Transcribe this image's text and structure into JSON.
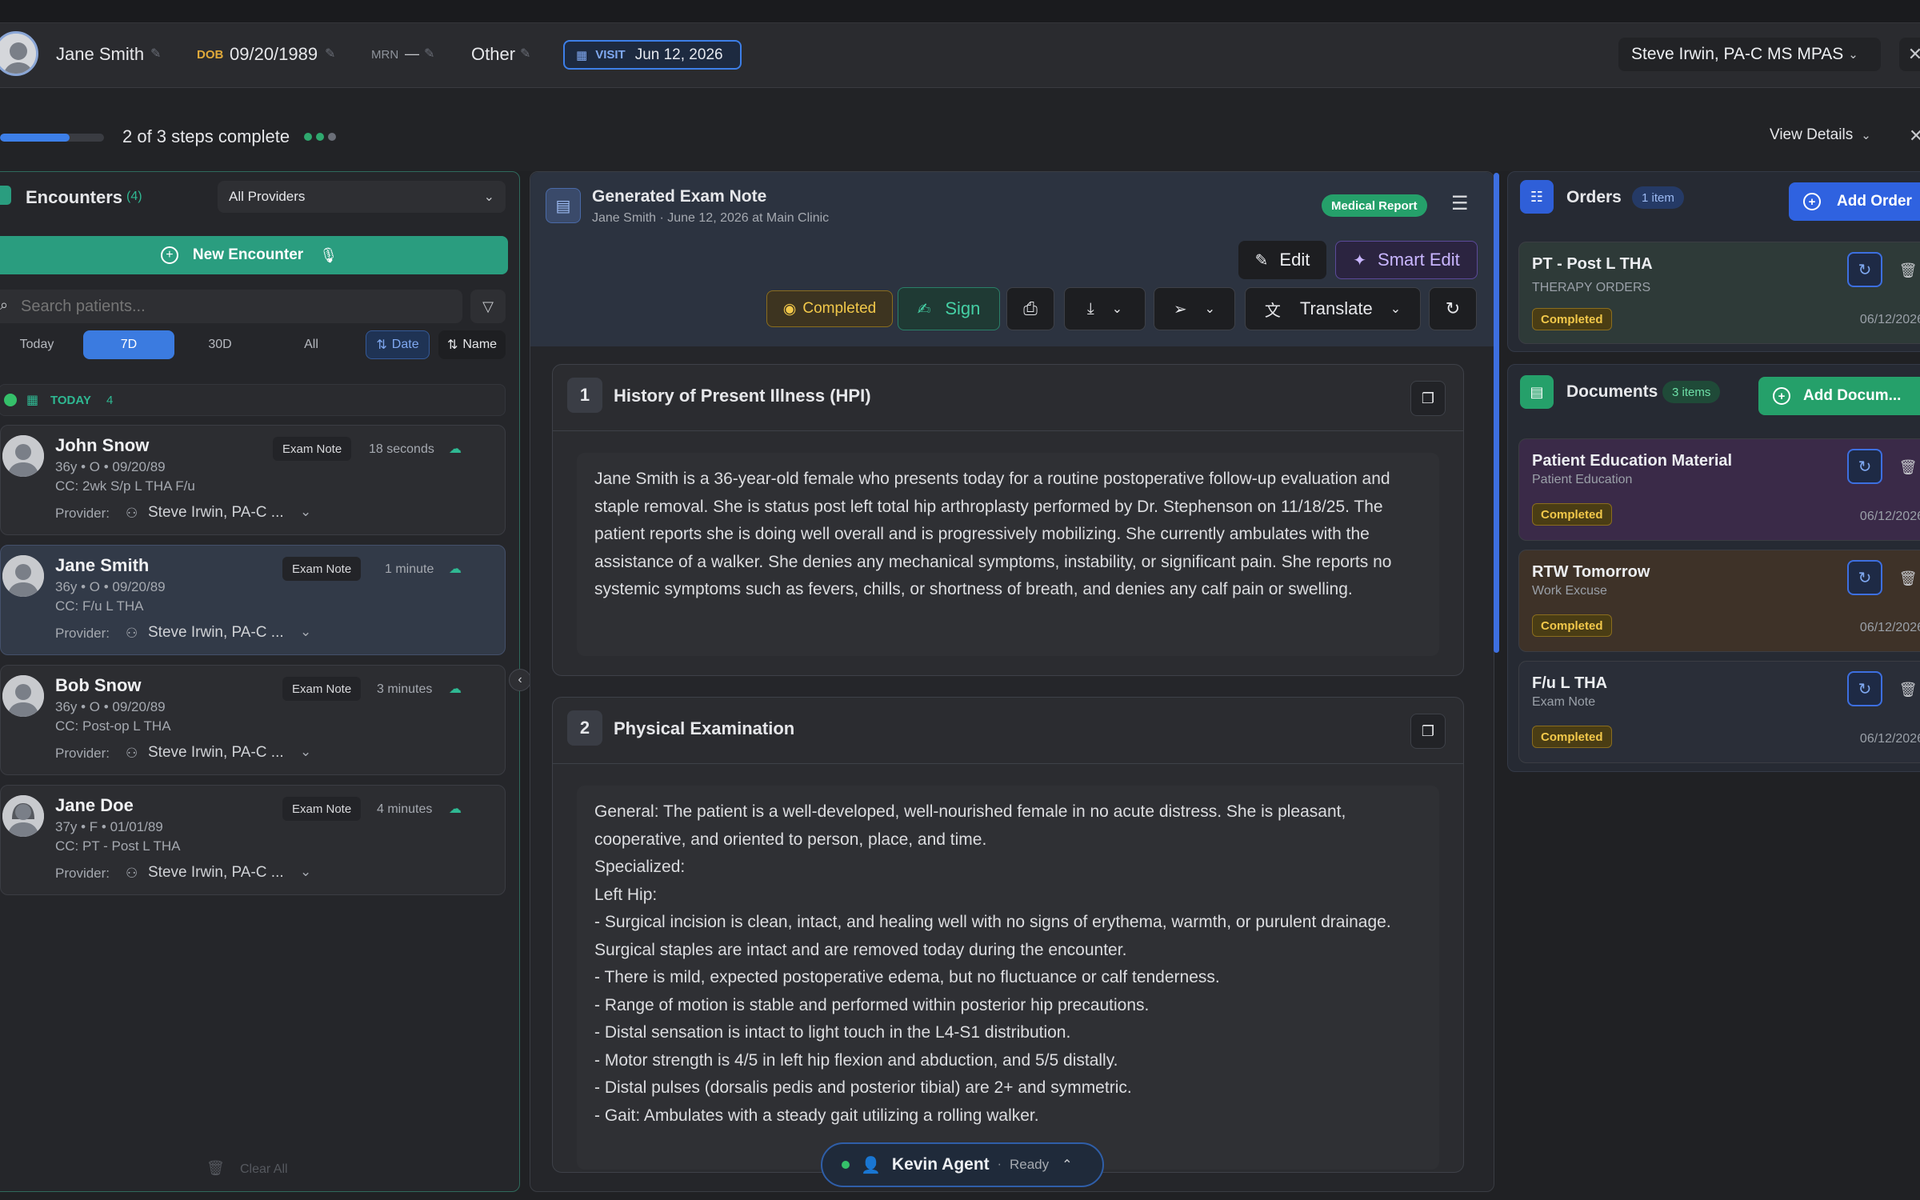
{
  "header": {
    "patient_name": "Jane Smith",
    "dob_label": "DOB",
    "dob_value": "09/20/1989",
    "mrn_label": "MRN",
    "mrn_value": "—",
    "sex_value": "Other",
    "visit_label": "VISIT",
    "visit_date": "Jun 12, 2026",
    "provider": "Steve Irwin, PA-C MS MPAS"
  },
  "progress": {
    "text": "2 of 3 steps complete",
    "fraction": 0.67,
    "view_details": "View Details"
  },
  "encounters": {
    "title": "Encounters",
    "count": "(4)",
    "provider_filter": "All Providers",
    "new_button": "New Encounter",
    "search_placeholder": "Search patients...",
    "ranges": [
      "Today",
      "7D",
      "30D",
      "All"
    ],
    "active_range": "7D",
    "sort_date": "Date",
    "sort_name": "Name",
    "group_label": "TODAY",
    "group_count": "4",
    "clear_all": "Clear All",
    "items": [
      {
        "name": "John Snow",
        "meta": "36y • O • 09/20/89",
        "cc": "CC: 2wk S/p L THA F/u",
        "tag": "Exam Note",
        "time": "18 seconds",
        "provider_label": "Provider:",
        "provider": "Steve Irwin, PA-C ..."
      },
      {
        "name": "Jane Smith",
        "meta": "36y • O • 09/20/89",
        "cc": "CC: F/u L THA",
        "tag": "Exam Note",
        "time": "1 minute",
        "provider_label": "Provider:",
        "provider": "Steve Irwin, PA-C ..."
      },
      {
        "name": "Bob Snow",
        "meta": "36y • O • 09/20/89",
        "cc": "CC: Post-op L THA",
        "tag": "Exam Note",
        "time": "3 minutes",
        "provider_label": "Provider:",
        "provider": "Steve Irwin, PA-C ..."
      },
      {
        "name": "Jane Doe",
        "meta": "37y • F • 01/01/89",
        "cc": "CC: PT - Post L THA",
        "tag": "Exam Note",
        "time": "4 minutes",
        "provider_label": "Provider:",
        "provider": "Steve Irwin, PA-C ..."
      }
    ]
  },
  "note": {
    "title": "Generated Exam Note",
    "subtitle": "Jane Smith · June 12, 2026 at Main Clinic",
    "badge": "Medical Report",
    "edit": "Edit",
    "smart_edit": "Smart Edit",
    "status": "Completed",
    "sign": "Sign",
    "translate": "Translate",
    "sections": [
      {
        "num": "1",
        "title": "History of Present Illness (HPI)",
        "body": "Jane Smith is a 36-year-old female who presents today for a routine postoperative follow-up evaluation and staple removal. She is status post left total hip arthroplasty performed by Dr. Stephenson on 11/18/25. The patient reports she is doing well overall and is progressively mobilizing. She currently ambulates with the assistance of a walker. She denies any mechanical symptoms, instability, or significant pain. She reports no systemic symptoms such as fevers, chills, or shortness of breath, and denies any calf pain or swelling."
      },
      {
        "num": "2",
        "title": "Physical Examination",
        "body": "General: The patient is a well-developed, well-nourished female in no acute distress. She is pleasant, cooperative, and oriented to person, place, and time.\nSpecialized:\nLeft Hip:\n- Surgical incision is clean, intact, and healing well with no signs of erythema, warmth, or purulent drainage. Surgical staples are intact and are removed today during the encounter.\n- There is mild, expected postoperative edema, but no fluctuance or calf tenderness.\n- Range of motion is stable and performed within posterior hip precautions.\n- Distal sensation is intact to light touch in the L4-S1 distribution.\n- Motor strength is 4/5 in left hip flexion and abduction, and 5/5 distally.\n- Distal pulses (dorsalis pedis and posterior tibial) are 2+ and symmetric.\n- Gait: Ambulates with a steady gait utilizing a rolling walker."
      }
    ]
  },
  "orders": {
    "title": "Orders",
    "count": "1 item",
    "add": "Add Order",
    "items": [
      {
        "title": "PT - Post L THA",
        "sub": "THERAPY ORDERS",
        "status": "Completed",
        "date": "06/12/2026"
      }
    ]
  },
  "documents": {
    "title": "Documents",
    "count": "3 items",
    "add": "Add Docum...",
    "items": [
      {
        "title": "Patient Education Material",
        "sub": "Patient Education",
        "status": "Completed",
        "date": "06/12/2026"
      },
      {
        "title": "RTW Tomorrow",
        "sub": "Work Excuse",
        "status": "Completed",
        "date": "06/12/2026"
      },
      {
        "title": "F/u L THA",
        "sub": "Exam Note",
        "status": "Completed",
        "date": "06/12/2026"
      }
    ]
  },
  "agent": {
    "name": "Kevin Agent",
    "status": "Ready"
  },
  "colors": {
    "accent_blue": "#3d6fe0",
    "accent_green": "#2a9d7f",
    "completed_yellow": "#f2c84a"
  }
}
